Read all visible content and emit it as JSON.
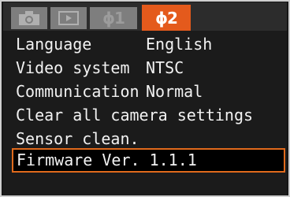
{
  "tabs": [
    {
      "icon": "camera-icon"
    },
    {
      "icon": "playback-icon"
    },
    {
      "label": "ϕ1",
      "icon": "wrench-icon"
    },
    {
      "label": "ϕ2",
      "icon": "wrench-icon",
      "active": true
    }
  ],
  "menu": {
    "items": [
      {
        "label": "Language",
        "value": "English"
      },
      {
        "label": "Video system",
        "value": "NTSC"
      },
      {
        "label": "Communication",
        "value": "Normal"
      },
      {
        "label": "Clear all camera settings",
        "value": ""
      },
      {
        "label": "Sensor clean.",
        "value": ""
      },
      {
        "label": "Firmware Ver. 1.1.1",
        "value": "",
        "selected": true
      }
    ]
  },
  "colors": {
    "accent": "#e45a1c",
    "tab_inactive": "#7e7e7e",
    "menu_bg": "#1b1b1b",
    "text": "#f2f2f2"
  }
}
